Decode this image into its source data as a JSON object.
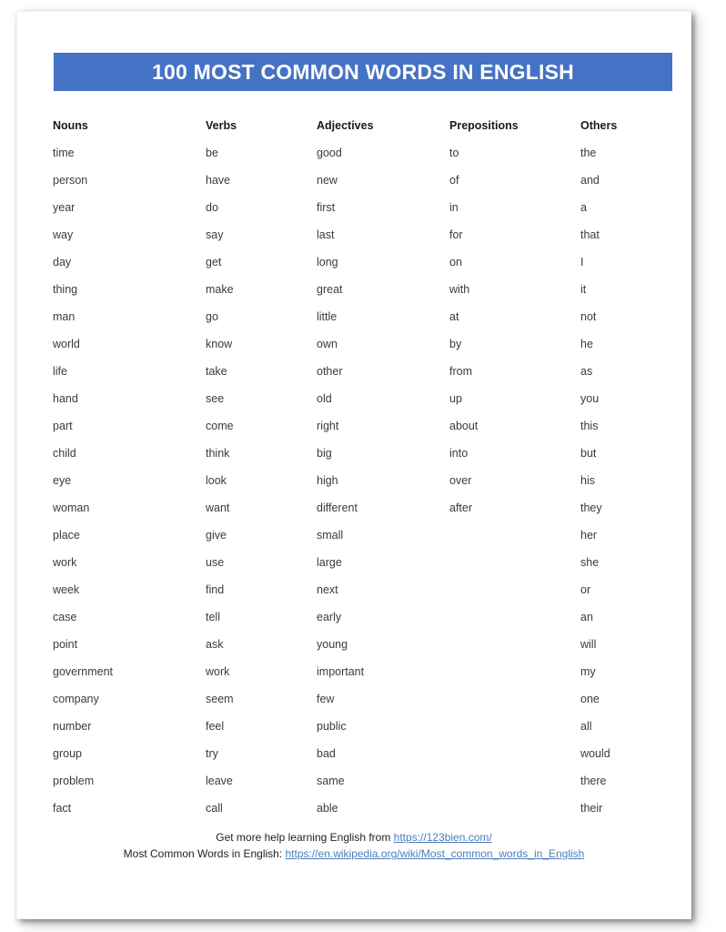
{
  "document": {
    "title": "100 MOST COMMON WORDS IN ENGLISH",
    "banner_color": "#4472C4",
    "title_color": "#FFFFFF",
    "page_background": "#FFFFFF"
  },
  "table": {
    "columns": [
      {
        "header": "Nouns",
        "words": [
          "time",
          "person",
          "year",
          "way",
          "day",
          "thing",
          "man",
          "world",
          "life",
          "hand",
          "part",
          "child",
          "eye",
          "woman",
          "place",
          "work",
          "week",
          "case",
          "point",
          "government",
          "company",
          "number",
          "group",
          "problem",
          "fact"
        ]
      },
      {
        "header": "Verbs",
        "words": [
          "be",
          "have",
          "do",
          "say",
          "get",
          "make",
          "go",
          "know",
          "take",
          "see",
          "come",
          "think",
          "look",
          "want",
          "give",
          "use",
          "find",
          "tell",
          "ask",
          "work",
          "seem",
          "feel",
          "try",
          "leave",
          "call"
        ]
      },
      {
        "header": "Adjectives",
        "words": [
          "good",
          "new",
          "first",
          "last",
          "long",
          "great",
          "little",
          "own",
          "other",
          "old",
          "right",
          "big",
          "high",
          "different",
          "small",
          "large",
          "next",
          "early",
          "young",
          "important",
          "few",
          "public",
          "bad",
          "same",
          "able"
        ]
      },
      {
        "header": "Prepositions",
        "words": [
          "to",
          "of",
          "in",
          "for",
          "on",
          "with",
          "at",
          "by",
          "from",
          "up",
          "about",
          "into",
          "over",
          "after"
        ]
      },
      {
        "header": "Others",
        "words": [
          "the",
          "and",
          "a",
          "that",
          "I",
          "it",
          "not",
          "he",
          "as",
          "you",
          "this",
          "but",
          "his",
          "they",
          "her",
          "she",
          "or",
          "an",
          "will",
          "my",
          "one",
          "all",
          "would",
          "there",
          "their"
        ]
      }
    ]
  },
  "footer": {
    "line1_prefix": "Get more help learning English from ",
    "line1_link": "https://123bien.com/",
    "line2_prefix": "Most Common Words in English:  ",
    "line2_link": "https://en.wikipedia.org/wiki/Most_common_words_in_English",
    "link_color": "#4A7EBB"
  }
}
